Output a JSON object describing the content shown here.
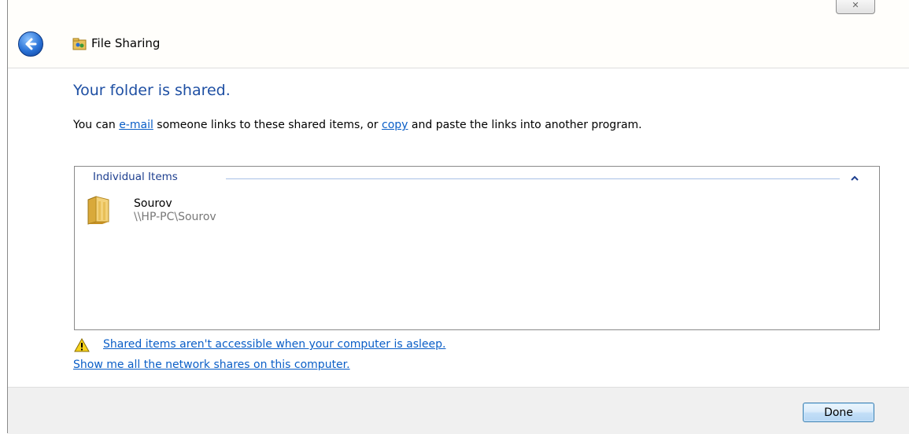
{
  "window": {
    "title": "File Sharing",
    "close_glyph": "✕"
  },
  "main": {
    "heading": "Your folder is shared.",
    "instructions": {
      "prefix": "You can ",
      "email_link": "e-mail",
      "middle": " someone links to these shared items, or ",
      "copy_link": "copy",
      "suffix": " and paste the links into another program."
    },
    "items_group": {
      "header": "Individual Items",
      "items": [
        {
          "name": "Sourov",
          "path": "\\\\HP-PC\\Sourov",
          "icon": "folder-icon"
        }
      ]
    },
    "warning_link": "Shared items aren't accessible when your computer is asleep.",
    "network_shares_link": "Show me all the network shares on this computer."
  },
  "footer": {
    "done_label": "Done"
  },
  "icons": {
    "back": "back-arrow-icon",
    "app": "file-sharing-icon",
    "warning": "warning-icon",
    "collapse": "chevron-up-icon"
  },
  "colors": {
    "heading": "#1e4fa3",
    "link": "#0a5ec7",
    "group_header": "#1e3f8f"
  }
}
